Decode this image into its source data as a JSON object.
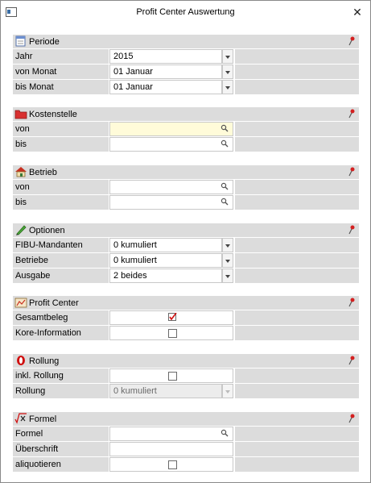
{
  "window": {
    "title": "Profit Center Auswertung",
    "close_label": "✕"
  },
  "sections": {
    "periode": {
      "title": "Periode",
      "rows": {
        "jahr": {
          "label": "Jahr",
          "value": "2015"
        },
        "von_monat": {
          "label": "von Monat",
          "value": "01 Januar"
        },
        "bis_monat": {
          "label": "bis Monat",
          "value": "01 Januar"
        }
      }
    },
    "kostenstelle": {
      "title": "Kostenstelle",
      "rows": {
        "von": {
          "label": "von",
          "value": ""
        },
        "bis": {
          "label": "bis",
          "value": ""
        }
      }
    },
    "betrieb": {
      "title": "Betrieb",
      "rows": {
        "von": {
          "label": "von",
          "value": ""
        },
        "bis": {
          "label": "bis",
          "value": ""
        }
      }
    },
    "optionen": {
      "title": "Optionen",
      "rows": {
        "fibu": {
          "label": "FIBU-Mandanten",
          "value": "0 kumuliert"
        },
        "betriebe": {
          "label": "Betriebe",
          "value": "0 kumuliert"
        },
        "ausgabe": {
          "label": "Ausgabe",
          "value": "2 beides"
        }
      }
    },
    "profit_center": {
      "title": "Profit Center",
      "rows": {
        "gesamtbeleg": {
          "label": "Gesamtbeleg",
          "checked": true
        },
        "kore": {
          "label": "Kore-Information",
          "checked": false
        }
      }
    },
    "rollung": {
      "title": "Rollung",
      "rows": {
        "inkl": {
          "label": "inkl. Rollung",
          "checked": false
        },
        "rollung": {
          "label": "Rollung",
          "value": "0 kumuliert"
        }
      }
    },
    "formel": {
      "title": "Formel",
      "rows": {
        "formel": {
          "label": "Formel",
          "value": ""
        },
        "ueberschrift": {
          "label": "Überschrift",
          "value": ""
        },
        "aliquotieren": {
          "label": "aliquotieren",
          "checked": false
        }
      }
    }
  }
}
